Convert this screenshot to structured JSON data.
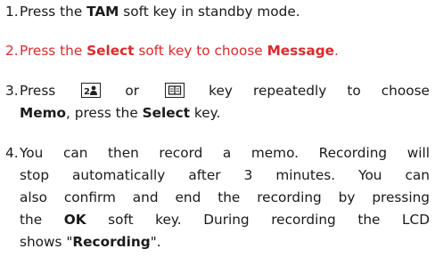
{
  "steps": [
    {
      "number": "1.",
      "parts": [
        "Press the ",
        "TAM",
        " soft key in standby mode."
      ]
    },
    {
      "number": "2.",
      "color": "#e0282a",
      "parts": [
        "Press the ",
        "Select",
        " soft key to choose ",
        "Message",
        "."
      ]
    },
    {
      "number": "3.",
      "line1": [
        "Press",
        "or",
        "key repeatedly to choose"
      ],
      "line2": [
        "Memo",
        ", press the ",
        "Select",
        " key."
      ],
      "icons": [
        "contacts-key-icon",
        "phonebook-key-icon"
      ]
    },
    {
      "number": "4.",
      "lines": [
        "You can then record a memo. Recording will",
        "stop automatically after 3 minutes. You can",
        "also confirm and end the recording by pressing"
      ],
      "line4": [
        "the ",
        "OK",
        " soft key. During recording the LCD"
      ],
      "line5": [
        "shows \"",
        "Recording",
        "\"."
      ]
    }
  ]
}
